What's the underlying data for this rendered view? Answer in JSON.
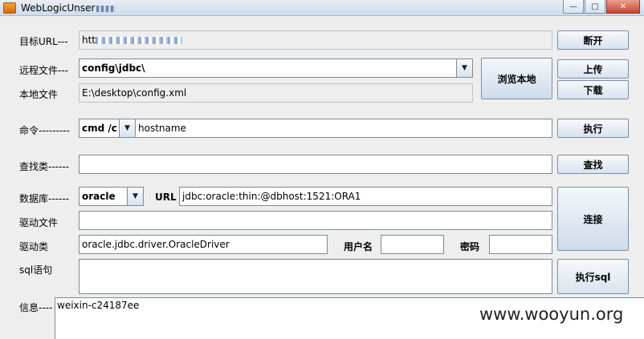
{
  "window": {
    "title": "WebLogicUnser",
    "minimize_glyph": "—",
    "maximize_glyph": "□",
    "close_glyph": "✕"
  },
  "target": {
    "label": "目标URL---",
    "value": "htt",
    "disconnect_button": "断开"
  },
  "remote_file": {
    "label": "远程文件---",
    "value": "config\\jdbc\\",
    "browse_button": "浏览本地",
    "upload_button": "上传",
    "download_button": "下载"
  },
  "local_file": {
    "label": "本地文件",
    "value": "E:\\desktop\\config.xml"
  },
  "command": {
    "label": "命令---------",
    "shell": "cmd /c",
    "value": "hostname",
    "execute_button": "执行"
  },
  "find_class": {
    "label": "查找类------",
    "value": "",
    "find_button": "查找"
  },
  "database": {
    "label": "数据库------",
    "type": "oracle",
    "url_label": "URL",
    "url_value": "jdbc:oracle:thin:@dbhost:1521:ORA1",
    "connect_button": "连接"
  },
  "driver_file": {
    "label": "驱动文件",
    "value": ""
  },
  "driver_class": {
    "label": "驱动类",
    "value": "oracle.jdbc.driver.OracleDriver",
    "username_label": "用户名",
    "username_value": "",
    "password_label": "密码",
    "password_value": ""
  },
  "sql": {
    "label": "sql语句",
    "value": "",
    "execute_sql_button": "执行sql"
  },
  "info": {
    "label": "信息----",
    "value": "weixin-c24187ee"
  },
  "watermark": "www.wooyun.org"
}
